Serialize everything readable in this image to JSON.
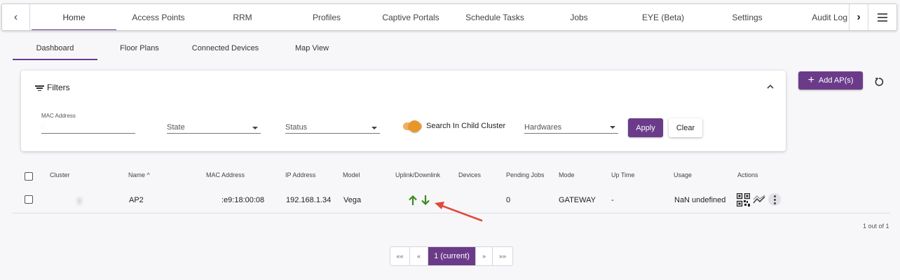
{
  "topnav": {
    "prev_label": "‹",
    "next_label": "›",
    "tabs": [
      {
        "label": "Home",
        "active": true
      },
      {
        "label": "Access Points"
      },
      {
        "label": "RRM"
      },
      {
        "label": "Profiles"
      },
      {
        "label": "Captive Portals"
      },
      {
        "label": "Schedule Tasks"
      },
      {
        "label": "Jobs"
      },
      {
        "label": "EYE (Beta)"
      },
      {
        "label": "Settings"
      },
      {
        "label": "Audit Log"
      }
    ]
  },
  "subnav": {
    "tabs": [
      {
        "label": "Dashboard",
        "active": true
      },
      {
        "label": "Floor Plans"
      },
      {
        "label": "Connected Devices"
      },
      {
        "label": "Map View"
      }
    ]
  },
  "filters": {
    "title": "Filters",
    "mac_label": "MAC Address",
    "mac_value": "·",
    "state_placeholder": "State",
    "status_placeholder": "Status",
    "child_cluster_label": "Search In Child Cluster",
    "child_cluster_enabled": true,
    "hardwares_placeholder": "Hardwares",
    "apply_label": "Apply",
    "clear_label": "Clear"
  },
  "toolbar": {
    "add_label": "Add AP(s)",
    "add_icon": "plus-icon",
    "refresh_icon": "refresh-icon"
  },
  "table": {
    "headers": {
      "cluster": "Cluster",
      "name": "Name ^",
      "mac": "MAC Address",
      "ip": "IP Address",
      "model": "Model",
      "uplink": "Uplink/Downlink",
      "devices": "Devices",
      "pending": "Pending Jobs",
      "mode": "Mode",
      "uptime": "Up Time",
      "usage": "Usage",
      "actions": "Actions"
    },
    "rows": [
      {
        "cluster": "y",
        "name": "AP2",
        "mac": ":e9:18:00:08",
        "ip": "192.168.1.34",
        "model": "Vega",
        "uplink_icon": "arrow-up-icon",
        "downlink_icon": "arrow-down-icon",
        "devices": "",
        "pending": "0",
        "mode": "GATEWAY",
        "uptime": "-",
        "usage": "NaN undefined"
      }
    ]
  },
  "pagination": {
    "summary": "1 out of 1",
    "first": "««",
    "prev": "«",
    "current": "1 (current)",
    "next": "»",
    "last": "»»"
  },
  "colors": {
    "accent": "#6b3b8a",
    "toggle": "#e8962a",
    "uplink": "#3a8a1e",
    "annotation_arrow": "#e04a3a"
  }
}
